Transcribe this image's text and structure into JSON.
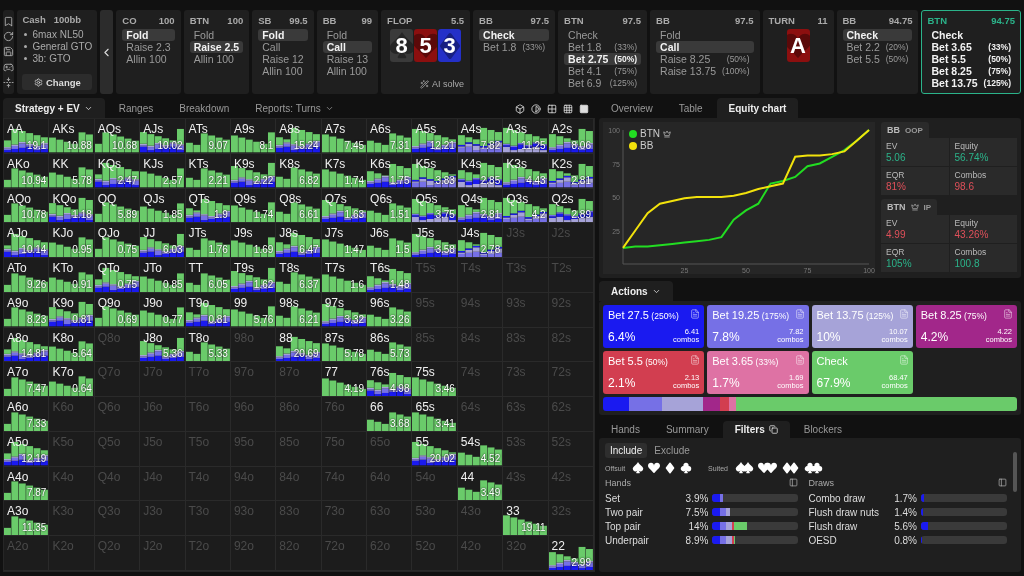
{
  "game": {
    "type": "Cash",
    "stack": "100bb",
    "items": [
      "6max NL50",
      "General GTO",
      "3b: GTO"
    ],
    "button": "Change"
  },
  "nav": [
    {
      "kind": "player",
      "position": "CO",
      "stack": "100",
      "current": false,
      "actions": [
        {
          "label": "Fold",
          "selected": true
        },
        {
          "label": "Raise 2.3",
          "selected": false
        },
        {
          "label": "Allin 100",
          "selected": false
        }
      ]
    },
    {
      "kind": "player",
      "position": "BTN",
      "stack": "100",
      "current": false,
      "actions": [
        {
          "label": "Fold",
          "selected": false
        },
        {
          "label": "Raise 2.5",
          "selected": true
        },
        {
          "label": "Allin 100",
          "selected": false
        }
      ]
    },
    {
      "kind": "player",
      "position": "SB",
      "stack": "99.5",
      "current": false,
      "actions": [
        {
          "label": "Fold",
          "selected": true
        },
        {
          "label": "Call",
          "selected": false
        },
        {
          "label": "Raise 12",
          "selected": false
        },
        {
          "label": "Allin 100",
          "selected": false
        }
      ]
    },
    {
      "kind": "player",
      "position": "BB",
      "stack": "99",
      "current": false,
      "actions": [
        {
          "label": "Fold",
          "selected": false
        },
        {
          "label": "Call",
          "selected": true
        },
        {
          "label": "Raise 13",
          "selected": false
        },
        {
          "label": "Allin 100",
          "selected": false
        }
      ]
    },
    {
      "kind": "board",
      "street": "FLOP",
      "pot": "5.5",
      "cards": [
        {
          "rank": "8",
          "kind": "spades"
        },
        {
          "rank": "5",
          "kind": "hearts"
        },
        {
          "rank": "3",
          "kind": "diamonds"
        }
      ],
      "solve": "AI solve"
    },
    {
      "kind": "player",
      "position": "BB",
      "stack": "97.5",
      "current": false,
      "actions": [
        {
          "label": "Check",
          "selected": true
        },
        {
          "label": "Bet 1.8",
          "pct": "(33%)",
          "selected": false
        }
      ]
    },
    {
      "kind": "player",
      "position": "BTN",
      "stack": "97.5",
      "current": false,
      "actions": [
        {
          "label": "Check",
          "selected": false
        },
        {
          "label": "Bet 1.8",
          "pct": "(33%)",
          "selected": false
        },
        {
          "label": "Bet 2.75",
          "pct": "(50%)",
          "selected": true
        },
        {
          "label": "Bet 4.1",
          "pct": "(75%)",
          "selected": false
        },
        {
          "label": "Bet 6.9",
          "pct": "(125%)",
          "selected": false
        }
      ]
    },
    {
      "kind": "player",
      "position": "BB",
      "stack": "97.5",
      "current": false,
      "actions": [
        {
          "label": "Fold",
          "selected": false
        },
        {
          "label": "Call",
          "selected": true
        },
        {
          "label": "Raise 8.25",
          "pct": "(50%)",
          "selected": false
        },
        {
          "label": "Raise 13.75",
          "pct": "(100%)",
          "selected": false
        }
      ]
    },
    {
      "kind": "board",
      "street": "TURN",
      "pot": "11",
      "cards": [
        {
          "rank": "A",
          "kind": "hearts"
        }
      ]
    },
    {
      "kind": "player",
      "position": "BB",
      "stack": "94.75",
      "current": false,
      "actions": [
        {
          "label": "Check",
          "selected": true
        },
        {
          "label": "Bet 2.2",
          "pct": "(20%)",
          "selected": false
        },
        {
          "label": "Bet 5.5",
          "pct": "(50%)",
          "selected": false
        }
      ]
    },
    {
      "kind": "player",
      "position": "BTN",
      "stack": "94.75",
      "current": true,
      "actions": [
        {
          "label": "Check",
          "selected": false
        },
        {
          "label": "Bet 3.65",
          "pct": "(33%)",
          "selected": false
        },
        {
          "label": "Bet 5.5",
          "pct": "(50%)",
          "selected": false
        },
        {
          "label": "Bet 8.25",
          "pct": "(75%)",
          "selected": false
        },
        {
          "label": "Bet 13.75",
          "pct": "(125%)",
          "selected": false
        }
      ]
    }
  ],
  "matrix_tabs": [
    {
      "label": "Strategy + EV",
      "selected": true,
      "dropdown": true
    },
    {
      "label": "Ranges",
      "selected": false,
      "dropdown": false
    },
    {
      "label": "Breakdown",
      "selected": false,
      "dropdown": false
    },
    {
      "label": "Reports: Turns",
      "selected": false,
      "dropdown": true
    }
  ],
  "matrix": [
    [
      {
        "hand": "AA",
        "ev": "19.1",
        "active": true
      },
      {
        "hand": "AKs",
        "ev": "10.88",
        "active": true
      },
      {
        "hand": "AQs",
        "ev": "10.68",
        "active": true
      },
      {
        "hand": "AJs",
        "ev": "10.02",
        "active": true
      },
      {
        "hand": "ATs",
        "ev": "9.07",
        "active": true
      },
      {
        "hand": "A9s",
        "ev": "8.1",
        "active": true
      },
      {
        "hand": "A8s",
        "ev": "15.24",
        "active": true
      },
      {
        "hand": "A7s",
        "ev": "7.45",
        "active": true
      },
      {
        "hand": "A6s",
        "ev": "7.31",
        "active": true
      },
      {
        "hand": "A5s",
        "ev": "12.21",
        "active": true
      },
      {
        "hand": "A4s",
        "ev": "7.82",
        "active": true
      },
      {
        "hand": "A3s",
        "ev": "11.25",
        "active": true
      },
      {
        "hand": "A2s",
        "ev": "8.06",
        "active": true
      }
    ],
    [
      {
        "hand": "AKo",
        "ev": "10.94",
        "active": true
      },
      {
        "hand": "KK",
        "ev": "5.78",
        "active": true
      },
      {
        "hand": "KQs",
        "ev": "2.47",
        "active": true
      },
      {
        "hand": "KJs",
        "ev": "2.57",
        "active": true
      },
      {
        "hand": "KTs",
        "ev": "2.21",
        "active": true
      },
      {
        "hand": "K9s",
        "ev": "2.22",
        "active": true
      },
      {
        "hand": "K8s",
        "ev": "6.82",
        "active": true
      },
      {
        "hand": "K7s",
        "ev": "1.74",
        "active": true
      },
      {
        "hand": "K6s",
        "ev": "1.75",
        "active": true
      },
      {
        "hand": "K5s",
        "ev": "3.83",
        "active": true
      },
      {
        "hand": "K4s",
        "ev": "2.85",
        "active": true
      },
      {
        "hand": "K3s",
        "ev": "4.43",
        "active": true
      },
      {
        "hand": "K2s",
        "ev": "2.81",
        "active": true
      }
    ],
    [
      {
        "hand": "AQo",
        "ev": "10.78",
        "active": true
      },
      {
        "hand": "KQo",
        "ev": "1.18",
        "active": true
      },
      {
        "hand": "QQ",
        "ev": "5.89",
        "active": true
      },
      {
        "hand": "QJs",
        "ev": "1.85",
        "active": true
      },
      {
        "hand": "QTs",
        "ev": "1.9",
        "active": true
      },
      {
        "hand": "Q9s",
        "ev": "1.74",
        "active": true
      },
      {
        "hand": "Q8s",
        "ev": "6.61",
        "active": true
      },
      {
        "hand": "Q7s",
        "ev": "1.63",
        "active": true
      },
      {
        "hand": "Q6s",
        "ev": "1.51",
        "active": true
      },
      {
        "hand": "Q5s",
        "ev": "3.75",
        "active": true
      },
      {
        "hand": "Q4s",
        "ev": "2.81",
        "active": true
      },
      {
        "hand": "Q3s",
        "ev": "4.2",
        "active": true
      },
      {
        "hand": "Q2s",
        "ev": "2.89",
        "active": true
      }
    ],
    [
      {
        "hand": "AJo",
        "ev": "10.14",
        "active": true
      },
      {
        "hand": "KJo",
        "ev": "0.95",
        "active": true
      },
      {
        "hand": "QJo",
        "ev": "0.75",
        "active": true
      },
      {
        "hand": "JJ",
        "ev": "6.03",
        "active": true
      },
      {
        "hand": "JTs",
        "ev": "1.76",
        "active": true
      },
      {
        "hand": "J9s",
        "ev": "1.69",
        "active": true
      },
      {
        "hand": "J8s",
        "ev": "6.47",
        "active": true
      },
      {
        "hand": "J7s",
        "ev": "1.47",
        "active": true
      },
      {
        "hand": "J6s",
        "ev": "1.5",
        "active": true
      },
      {
        "hand": "J5s",
        "ev": "3.58",
        "active": true
      },
      {
        "hand": "J4s",
        "ev": "2.78",
        "active": true
      },
      {
        "hand": "J3s",
        "active": false
      },
      {
        "hand": "J2s",
        "active": false
      }
    ],
    [
      {
        "hand": "ATo",
        "ev": "9.26",
        "active": true
      },
      {
        "hand": "KTo",
        "ev": "0.91",
        "active": true
      },
      {
        "hand": "QTo",
        "ev": "0.75",
        "active": true
      },
      {
        "hand": "JTo",
        "ev": "0.85",
        "active": true
      },
      {
        "hand": "TT",
        "ev": "6.05",
        "active": true
      },
      {
        "hand": "T9s",
        "ev": "1.62",
        "active": true
      },
      {
        "hand": "T8s",
        "ev": "6.37",
        "active": true
      },
      {
        "hand": "T7s",
        "ev": "1.6",
        "active": true
      },
      {
        "hand": "T6s",
        "ev": "1.48",
        "active": true
      },
      {
        "hand": "T5s",
        "active": false
      },
      {
        "hand": "T4s",
        "active": false
      },
      {
        "hand": "T3s",
        "active": false
      },
      {
        "hand": "T2s",
        "active": false
      }
    ],
    [
      {
        "hand": "A9o",
        "ev": "8.23",
        "active": true
      },
      {
        "hand": "K9o",
        "ev": "0.81",
        "active": true
      },
      {
        "hand": "Q9o",
        "ev": "0.69",
        "active": true
      },
      {
        "hand": "J9o",
        "ev": "0.77",
        "active": true
      },
      {
        "hand": "T9o",
        "ev": "0.81",
        "active": true
      },
      {
        "hand": "99",
        "ev": "5.76",
        "active": true
      },
      {
        "hand": "98s",
        "ev": "6.21",
        "active": true
      },
      {
        "hand": "97s",
        "ev": "3.32",
        "active": true
      },
      {
        "hand": "96s",
        "ev": "3.26",
        "active": true
      },
      {
        "hand": "95s",
        "active": false
      },
      {
        "hand": "94s",
        "active": false
      },
      {
        "hand": "93s",
        "active": false
      },
      {
        "hand": "92s",
        "active": false
      }
    ],
    [
      {
        "hand": "A8o",
        "ev": "14.81",
        "active": true
      },
      {
        "hand": "K8o",
        "ev": "5.64",
        "active": true
      },
      {
        "hand": "Q8o",
        "active": false
      },
      {
        "hand": "J8o",
        "ev": "5.36",
        "active": true
      },
      {
        "hand": "T8o",
        "ev": "5.33",
        "active": true
      },
      {
        "hand": "98o",
        "active": false
      },
      {
        "hand": "88",
        "ev": "20.69",
        "active": true
      },
      {
        "hand": "87s",
        "ev": "5.78",
        "active": true
      },
      {
        "hand": "86s",
        "ev": "5.73",
        "active": true
      },
      {
        "hand": "85s",
        "active": false
      },
      {
        "hand": "84s",
        "active": false
      },
      {
        "hand": "83s",
        "active": false
      },
      {
        "hand": "82s",
        "active": false
      }
    ],
    [
      {
        "hand": "A7o",
        "ev": "7.47",
        "active": true
      },
      {
        "hand": "K7o",
        "ev": "0.64",
        "active": true
      },
      {
        "hand": "Q7o",
        "active": false
      },
      {
        "hand": "J7o",
        "active": false
      },
      {
        "hand": "T7o",
        "active": false
      },
      {
        "hand": "97o",
        "active": false
      },
      {
        "hand": "87o",
        "active": false
      },
      {
        "hand": "77",
        "ev": "4.19",
        "active": true
      },
      {
        "hand": "76s",
        "ev": "4.98",
        "active": true
      },
      {
        "hand": "75s",
        "ev": "3.46",
        "active": true
      },
      {
        "hand": "74s",
        "active": false
      },
      {
        "hand": "73s",
        "active": false
      },
      {
        "hand": "72s",
        "active": false
      }
    ],
    [
      {
        "hand": "A6o",
        "ev": "7.33",
        "active": true
      },
      {
        "hand": "K6o",
        "active": false
      },
      {
        "hand": "Q6o",
        "active": false
      },
      {
        "hand": "J6o",
        "active": false
      },
      {
        "hand": "T6o",
        "active": false
      },
      {
        "hand": "96o",
        "active": false
      },
      {
        "hand": "86o",
        "active": false
      },
      {
        "hand": "76o",
        "active": false
      },
      {
        "hand": "66",
        "ev": "3.68",
        "active": true
      },
      {
        "hand": "65s",
        "ev": "3.41",
        "active": true
      },
      {
        "hand": "64s",
        "active": false
      },
      {
        "hand": "63s",
        "active": false
      },
      {
        "hand": "62s",
        "active": false
      }
    ],
    [
      {
        "hand": "A5o",
        "ev": "12.19",
        "active": true
      },
      {
        "hand": "K5o",
        "active": false
      },
      {
        "hand": "Q5o",
        "active": false
      },
      {
        "hand": "J5o",
        "active": false
      },
      {
        "hand": "T5o",
        "active": false
      },
      {
        "hand": "95o",
        "active": false
      },
      {
        "hand": "85o",
        "active": false
      },
      {
        "hand": "75o",
        "active": false
      },
      {
        "hand": "65o",
        "active": false
      },
      {
        "hand": "55",
        "ev": "20.02",
        "active": true
      },
      {
        "hand": "54s",
        "ev": "4.52",
        "active": true
      },
      {
        "hand": "53s",
        "active": false
      },
      {
        "hand": "52s",
        "active": false
      }
    ],
    [
      {
        "hand": "A4o",
        "ev": "7.87",
        "active": true
      },
      {
        "hand": "K4o",
        "active": false
      },
      {
        "hand": "Q4o",
        "active": false
      },
      {
        "hand": "J4o",
        "active": false
      },
      {
        "hand": "T4o",
        "active": false
      },
      {
        "hand": "94o",
        "active": false
      },
      {
        "hand": "84o",
        "active": false
      },
      {
        "hand": "74o",
        "active": false
      },
      {
        "hand": "64o",
        "active": false
      },
      {
        "hand": "54o",
        "active": false
      },
      {
        "hand": "44",
        "ev": "3.49",
        "active": true
      },
      {
        "hand": "43s",
        "active": false
      },
      {
        "hand": "42s",
        "active": false
      }
    ],
    [
      {
        "hand": "A3o",
        "ev": "11.35",
        "active": true
      },
      {
        "hand": "K3o",
        "active": false
      },
      {
        "hand": "Q3o",
        "active": false
      },
      {
        "hand": "J3o",
        "active": false
      },
      {
        "hand": "T3o",
        "active": false
      },
      {
        "hand": "93o",
        "active": false
      },
      {
        "hand": "83o",
        "active": false
      },
      {
        "hand": "73o",
        "active": false
      },
      {
        "hand": "63o",
        "active": false
      },
      {
        "hand": "53o",
        "active": false
      },
      {
        "hand": "43o",
        "active": false
      },
      {
        "hand": "33",
        "ev": "19.11",
        "active": true
      },
      {
        "hand": "32s",
        "active": false
      }
    ],
    [
      {
        "hand": "A2o",
        "active": false
      },
      {
        "hand": "K2o",
        "active": false
      },
      {
        "hand": "Q2o",
        "active": false
      },
      {
        "hand": "J2o",
        "active": false
      },
      {
        "hand": "T2o",
        "active": false
      },
      {
        "hand": "92o",
        "active": false
      },
      {
        "hand": "82o",
        "active": false
      },
      {
        "hand": "72o",
        "active": false
      },
      {
        "hand": "62o",
        "active": false
      },
      {
        "hand": "52o",
        "active": false
      },
      {
        "hand": "42o",
        "active": false
      },
      {
        "hand": "32o",
        "active": false
      },
      {
        "hand": "22",
        "ev": "2.99",
        "active": true
      }
    ]
  ],
  "panel_tabs": [
    {
      "label": "Overview",
      "selected": false
    },
    {
      "label": "Table",
      "selected": false
    },
    {
      "label": "Equity chart",
      "selected": true
    }
  ],
  "equity": {
    "legend": [
      {
        "crown": true
      },
      {
        "crown": false
      }
    ],
    "chart_data": {
      "type": "line",
      "x": [
        0,
        5,
        10,
        15,
        20,
        25,
        30,
        35,
        40,
        45,
        50,
        55,
        60,
        65,
        70,
        75,
        80,
        85,
        90,
        95,
        100
      ],
      "series": [
        {
          "name": "BTN",
          "color": "#22dd22",
          "values": [
            12,
            13,
            13,
            14,
            15,
            16,
            17,
            18,
            20,
            33,
            40,
            45,
            60,
            62,
            65,
            73,
            75,
            80,
            85,
            92,
            100
          ]
        },
        {
          "name": "BB",
          "color": "#f2e20c",
          "values": [
            12,
            25,
            38,
            45,
            47,
            49,
            50,
            50,
            50,
            51,
            53,
            56,
            58,
            60,
            80,
            81,
            81,
            82,
            84,
            92,
            100
          ]
        }
      ],
      "xlim": [
        0,
        100
      ],
      "ylim": [
        0,
        100
      ],
      "xticks": [
        25,
        50,
        75,
        100
      ],
      "yticks": [
        25,
        50,
        75,
        100
      ]
    }
  },
  "stats": [
    {
      "player": "BB",
      "role": "OOP",
      "crown": false,
      "metrics": [
        {
          "label": "EV",
          "value": "5.06",
          "positive": true
        },
        {
          "label": "Equity",
          "value": "56.74%",
          "positive": true
        },
        {
          "label": "EQR",
          "value": "81%",
          "positive": false
        },
        {
          "label": "Combos",
          "value": "98.6",
          "positive": false
        }
      ]
    },
    {
      "player": "BTN",
      "role": "IP",
      "crown": true,
      "metrics": [
        {
          "label": "EV",
          "value": "4.99",
          "positive": false
        },
        {
          "label": "Equity",
          "value": "43.26%",
          "positive": false
        },
        {
          "label": "EQR",
          "value": "105%",
          "positive": true
        },
        {
          "label": "Combos",
          "value": "100.8",
          "positive": true
        }
      ]
    }
  ],
  "actions_header": "Actions",
  "actions": [
    {
      "label": "Bet 27.5",
      "pct": "(250%)",
      "share": "6.4%",
      "combos": "6.41",
      "unit": "combos",
      "color": "#1a1af0"
    },
    {
      "label": "Bet 19.25",
      "pct": "(175%)",
      "share": "7.8%",
      "combos": "7.82",
      "unit": "combos",
      "color": "#7670e6"
    },
    {
      "label": "Bet 13.75",
      "pct": "(125%)",
      "share": "10%",
      "combos": "10.07",
      "unit": "combos",
      "color": "#a6a3d8"
    },
    {
      "label": "Bet 8.25",
      "pct": "(75%)",
      "share": "4.2%",
      "combos": "4.22",
      "unit": "combos",
      "color": "#a2278a"
    },
    {
      "label": "Bet 5.5",
      "pct": "(50%)",
      "share": "2.1%",
      "combos": "2.13",
      "unit": "combos",
      "color": "#d23e50"
    },
    {
      "label": "Bet 3.65",
      "pct": "(33%)",
      "share": "1.7%",
      "combos": "1.69",
      "unit": "combos",
      "color": "#de72a4"
    },
    {
      "label": "Check",
      "share": "67.9%",
      "combos": "68.47",
      "unit": "combos",
      "color": "#6acb6a"
    }
  ],
  "bottom_tabs": [
    {
      "label": "Hands",
      "selected": false
    },
    {
      "label": "Summary",
      "selected": false
    },
    {
      "label": "Filters",
      "selected": true
    },
    {
      "label": "Blockers",
      "selected": false
    }
  ],
  "filter_mode": [
    {
      "label": "Include",
      "selected": true
    },
    {
      "label": "Exclude",
      "selected": false
    }
  ],
  "suit_labels": [
    "Offsuit",
    "Suited"
  ],
  "groups": [
    {
      "title": "Hands",
      "rows": [
        {
          "name": "Set",
          "pct": "3.9%",
          "level": 0.12
        },
        {
          "name": "Two pair",
          "pct": "7.5%",
          "level": 0.21
        },
        {
          "name": "Top pair",
          "pct": "14%",
          "level": 0.4
        },
        {
          "name": "Underpair",
          "pct": "8.9%",
          "level": 0.26
        }
      ]
    },
    {
      "title": "Draws",
      "rows": [
        {
          "name": "Combo draw",
          "pct": "1.7%",
          "level": 0.03
        },
        {
          "name": "Flush draw nuts",
          "pct": "1.4%",
          "level": 0.02
        },
        {
          "name": "Flush draw",
          "pct": "5.6%",
          "level": 0.08
        },
        {
          "name": "OESD",
          "pct": "0.8%",
          "level": 0.015
        }
      ]
    }
  ]
}
